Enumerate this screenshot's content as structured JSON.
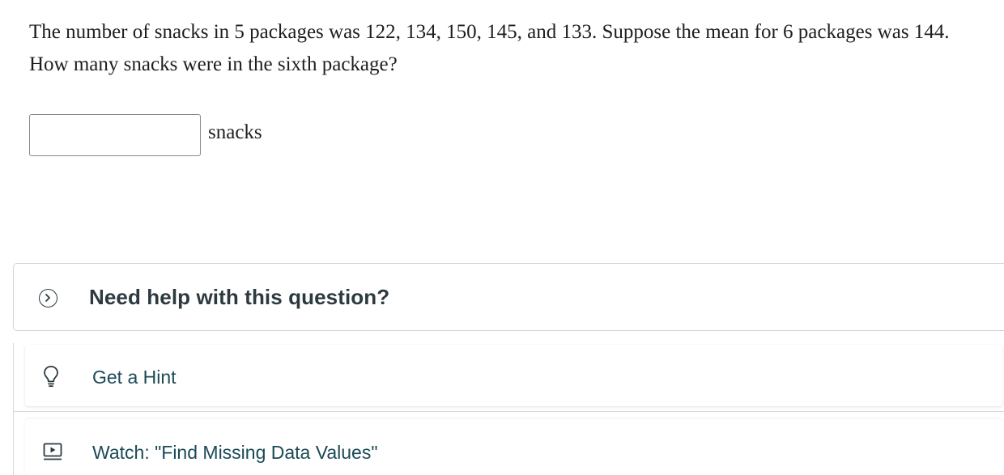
{
  "question": {
    "text": "The number of snacks in 5 packages was 122, 134, 150, 145, and 133. Suppose the mean for 6 packages was 144. How many snacks were in the sixth package?"
  },
  "answer": {
    "value": "",
    "placeholder": "",
    "unit": "snacks"
  },
  "help": {
    "toggle_label": "Need help with this question?",
    "items": [
      {
        "label": "Get a Hint",
        "icon": "lightbulb-icon"
      },
      {
        "label": "Watch: \"Find Missing Data Values\"",
        "icon": "video-icon"
      }
    ]
  },
  "colors": {
    "text": "#1e1e1e",
    "help_text": "#2c3a40",
    "link_text": "#1b4a57",
    "border": "#cfd5d9"
  }
}
